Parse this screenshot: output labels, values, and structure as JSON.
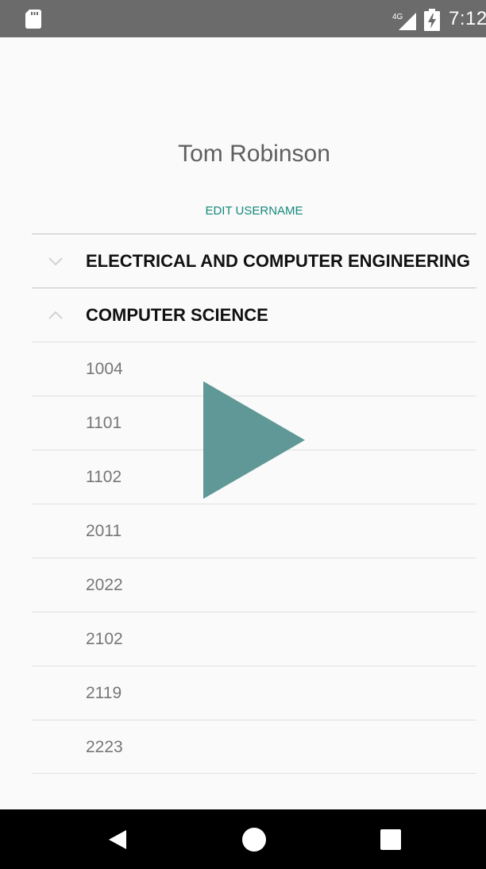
{
  "status_bar": {
    "time": "7:12",
    "network": "4G"
  },
  "profile": {
    "username": "Tom Robinson",
    "edit_label": "EDIT USERNAME"
  },
  "groups": [
    {
      "title": "ELECTRICAL AND COMPUTER ENGINEERING",
      "expanded": false
    },
    {
      "title": "COMPUTER SCIENCE",
      "expanded": true,
      "courses": [
        "1004",
        "1101",
        "1102",
        "2011",
        "2022",
        "2102",
        "2119",
        "2223"
      ]
    }
  ],
  "colors": {
    "accent": "#16897c",
    "play_overlay": "#5f9896",
    "status_bar": "#6b6b6b",
    "nav_bar": "#000000"
  },
  "icons": {
    "status": [
      "sd-card-icon",
      "signal-icon",
      "battery-charging-icon"
    ],
    "nav": [
      "back-icon",
      "home-icon",
      "recents-icon"
    ],
    "overlay": "play-icon"
  }
}
